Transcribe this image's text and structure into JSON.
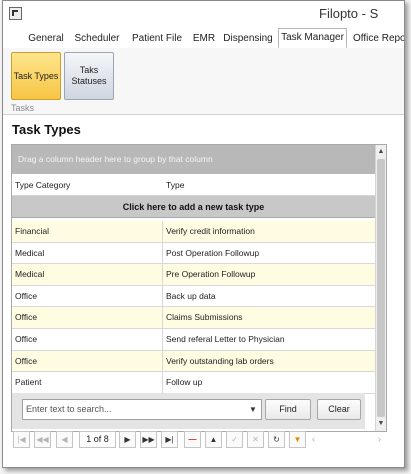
{
  "window": {
    "title": "Filopto - S"
  },
  "tabs": [
    {
      "label": "General"
    },
    {
      "label": "Scheduler"
    },
    {
      "label": "Patient File"
    },
    {
      "label": "EMR"
    },
    {
      "label": "Dispensing"
    },
    {
      "label": "Task Manager",
      "active": true
    },
    {
      "label": "Office Repo"
    }
  ],
  "ribbon": {
    "buttons": [
      {
        "label": "Task Types",
        "selected": true
      },
      {
        "label": "Taks Statuses",
        "selected": false
      }
    ],
    "group_label": "Tasks"
  },
  "page": {
    "title": "Task Types"
  },
  "grid": {
    "group_panel_text": "Drag a column header here to group by that column",
    "columns": [
      "Type Category",
      "Type"
    ],
    "add_row_text": "Click here to add a new task type",
    "rows": [
      [
        "Financial",
        "Verify credit information"
      ],
      [
        "Medical",
        "Post Operation Followup"
      ],
      [
        "Medical",
        "Pre Operation Followup"
      ],
      [
        "Office",
        "Back up data"
      ],
      [
        "Office",
        "Claims Submissions"
      ],
      [
        "Office",
        "Send  referal Letter to Physician"
      ],
      [
        "Office",
        "Verify outstanding lab orders"
      ],
      [
        "Patient",
        "Follow up"
      ]
    ]
  },
  "search": {
    "placeholder": "Enter text to search...",
    "find_label": "Find",
    "clear_label": "Clear"
  },
  "pager": {
    "page_label": "1 of 8"
  },
  "colors": {
    "selected_row": "#fffce2",
    "ribbon_selected": "#f7c545",
    "group_panel": "#b8b8b8"
  }
}
